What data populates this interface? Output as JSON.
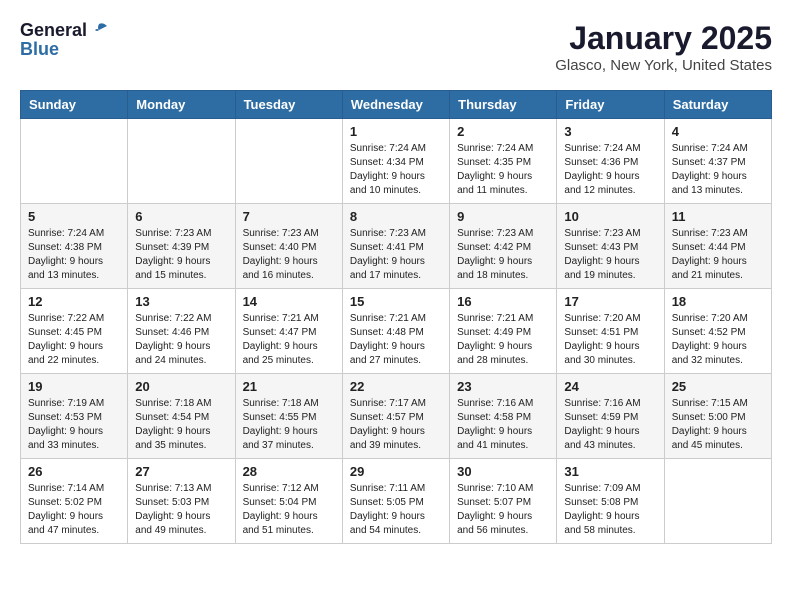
{
  "header": {
    "logo_general": "General",
    "logo_blue": "Blue",
    "month": "January 2025",
    "location": "Glasco, New York, United States"
  },
  "weekdays": [
    "Sunday",
    "Monday",
    "Tuesday",
    "Wednesday",
    "Thursday",
    "Friday",
    "Saturday"
  ],
  "weeks": [
    [
      {
        "day": "",
        "info": ""
      },
      {
        "day": "",
        "info": ""
      },
      {
        "day": "",
        "info": ""
      },
      {
        "day": "1",
        "info": "Sunrise: 7:24 AM\nSunset: 4:34 PM\nDaylight: 9 hours\nand 10 minutes."
      },
      {
        "day": "2",
        "info": "Sunrise: 7:24 AM\nSunset: 4:35 PM\nDaylight: 9 hours\nand 11 minutes."
      },
      {
        "day": "3",
        "info": "Sunrise: 7:24 AM\nSunset: 4:36 PM\nDaylight: 9 hours\nand 12 minutes."
      },
      {
        "day": "4",
        "info": "Sunrise: 7:24 AM\nSunset: 4:37 PM\nDaylight: 9 hours\nand 13 minutes."
      }
    ],
    [
      {
        "day": "5",
        "info": "Sunrise: 7:24 AM\nSunset: 4:38 PM\nDaylight: 9 hours\nand 13 minutes."
      },
      {
        "day": "6",
        "info": "Sunrise: 7:23 AM\nSunset: 4:39 PM\nDaylight: 9 hours\nand 15 minutes."
      },
      {
        "day": "7",
        "info": "Sunrise: 7:23 AM\nSunset: 4:40 PM\nDaylight: 9 hours\nand 16 minutes."
      },
      {
        "day": "8",
        "info": "Sunrise: 7:23 AM\nSunset: 4:41 PM\nDaylight: 9 hours\nand 17 minutes."
      },
      {
        "day": "9",
        "info": "Sunrise: 7:23 AM\nSunset: 4:42 PM\nDaylight: 9 hours\nand 18 minutes."
      },
      {
        "day": "10",
        "info": "Sunrise: 7:23 AM\nSunset: 4:43 PM\nDaylight: 9 hours\nand 19 minutes."
      },
      {
        "day": "11",
        "info": "Sunrise: 7:23 AM\nSunset: 4:44 PM\nDaylight: 9 hours\nand 21 minutes."
      }
    ],
    [
      {
        "day": "12",
        "info": "Sunrise: 7:22 AM\nSunset: 4:45 PM\nDaylight: 9 hours\nand 22 minutes."
      },
      {
        "day": "13",
        "info": "Sunrise: 7:22 AM\nSunset: 4:46 PM\nDaylight: 9 hours\nand 24 minutes."
      },
      {
        "day": "14",
        "info": "Sunrise: 7:21 AM\nSunset: 4:47 PM\nDaylight: 9 hours\nand 25 minutes."
      },
      {
        "day": "15",
        "info": "Sunrise: 7:21 AM\nSunset: 4:48 PM\nDaylight: 9 hours\nand 27 minutes."
      },
      {
        "day": "16",
        "info": "Sunrise: 7:21 AM\nSunset: 4:49 PM\nDaylight: 9 hours\nand 28 minutes."
      },
      {
        "day": "17",
        "info": "Sunrise: 7:20 AM\nSunset: 4:51 PM\nDaylight: 9 hours\nand 30 minutes."
      },
      {
        "day": "18",
        "info": "Sunrise: 7:20 AM\nSunset: 4:52 PM\nDaylight: 9 hours\nand 32 minutes."
      }
    ],
    [
      {
        "day": "19",
        "info": "Sunrise: 7:19 AM\nSunset: 4:53 PM\nDaylight: 9 hours\nand 33 minutes."
      },
      {
        "day": "20",
        "info": "Sunrise: 7:18 AM\nSunset: 4:54 PM\nDaylight: 9 hours\nand 35 minutes."
      },
      {
        "day": "21",
        "info": "Sunrise: 7:18 AM\nSunset: 4:55 PM\nDaylight: 9 hours\nand 37 minutes."
      },
      {
        "day": "22",
        "info": "Sunrise: 7:17 AM\nSunset: 4:57 PM\nDaylight: 9 hours\nand 39 minutes."
      },
      {
        "day": "23",
        "info": "Sunrise: 7:16 AM\nSunset: 4:58 PM\nDaylight: 9 hours\nand 41 minutes."
      },
      {
        "day": "24",
        "info": "Sunrise: 7:16 AM\nSunset: 4:59 PM\nDaylight: 9 hours\nand 43 minutes."
      },
      {
        "day": "25",
        "info": "Sunrise: 7:15 AM\nSunset: 5:00 PM\nDaylight: 9 hours\nand 45 minutes."
      }
    ],
    [
      {
        "day": "26",
        "info": "Sunrise: 7:14 AM\nSunset: 5:02 PM\nDaylight: 9 hours\nand 47 minutes."
      },
      {
        "day": "27",
        "info": "Sunrise: 7:13 AM\nSunset: 5:03 PM\nDaylight: 9 hours\nand 49 minutes."
      },
      {
        "day": "28",
        "info": "Sunrise: 7:12 AM\nSunset: 5:04 PM\nDaylight: 9 hours\nand 51 minutes."
      },
      {
        "day": "29",
        "info": "Sunrise: 7:11 AM\nSunset: 5:05 PM\nDaylight: 9 hours\nand 54 minutes."
      },
      {
        "day": "30",
        "info": "Sunrise: 7:10 AM\nSunset: 5:07 PM\nDaylight: 9 hours\nand 56 minutes."
      },
      {
        "day": "31",
        "info": "Sunrise: 7:09 AM\nSunset: 5:08 PM\nDaylight: 9 hours\nand 58 minutes."
      },
      {
        "day": "",
        "info": ""
      }
    ]
  ]
}
